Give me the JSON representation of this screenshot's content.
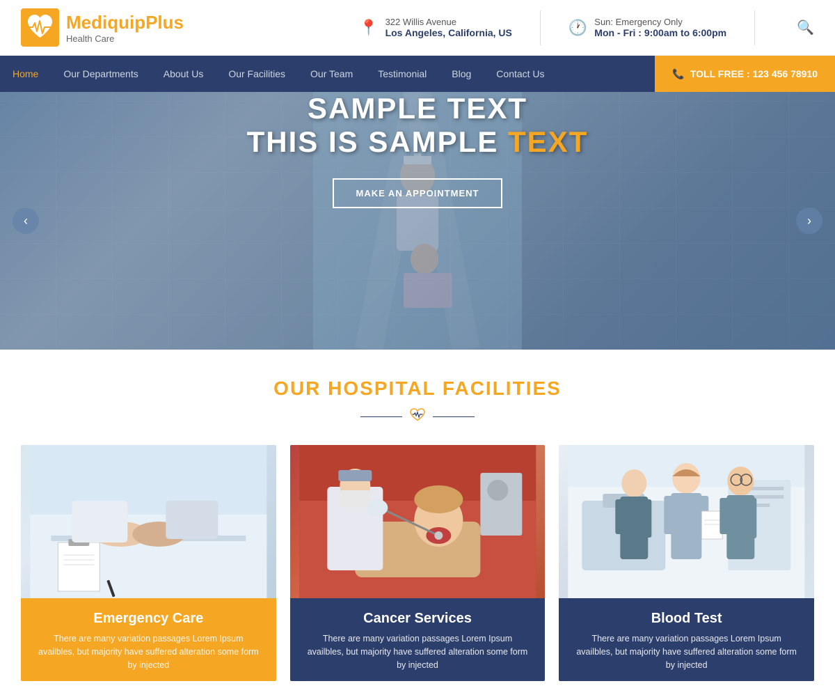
{
  "brand": {
    "name1": "Mediquip",
    "name2": "Plus",
    "tagline": "Health Care"
  },
  "header": {
    "address_line1": "322 Willis Avenue",
    "address_line2": "Los Angeles, California, US",
    "hours_line1": "Sun: Emergency Only",
    "hours_line2": "Mon - Fri : 9:00am to 6:00pm"
  },
  "nav": {
    "items": [
      {
        "label": "Home",
        "active": true
      },
      {
        "label": "Our Departments",
        "active": false
      },
      {
        "label": "About Us",
        "active": false
      },
      {
        "label": "Our Facilities",
        "active": false
      },
      {
        "label": "Our Team",
        "active": false
      },
      {
        "label": "Testimonial",
        "active": false
      },
      {
        "label": "Blog",
        "active": false
      },
      {
        "label": "Contact Us",
        "active": false
      }
    ],
    "toll_free_label": "TOLL FREE : 123 456 78910"
  },
  "hero": {
    "line1": "SAMPLE TEXT",
    "line2_part1": "THIS IS SAMPLE ",
    "line2_part2": "TEXT",
    "cta_label": "MAKE AN APPOINTMENT",
    "prev_arrow": "‹",
    "next_arrow": "›"
  },
  "facilities": {
    "section_title": "OUR HOSPITAL FACILITIES",
    "cards": [
      {
        "title": "Emergency Care",
        "description": "There are many variation passages Lorem Ipsum availbles, but  majority have suffered alteration some form by injected",
        "color": "orange"
      },
      {
        "title": "Cancer Services",
        "description": "There are many variation passages Lorem Ipsum availbles, but  majority have suffered alteration some form by injected",
        "color": "blue"
      },
      {
        "title": "Blood Test",
        "description": "There are many variation passages Lorem Ipsum availbles, but  majority have suffered alteration some form by injected",
        "color": "blue"
      }
    ]
  }
}
